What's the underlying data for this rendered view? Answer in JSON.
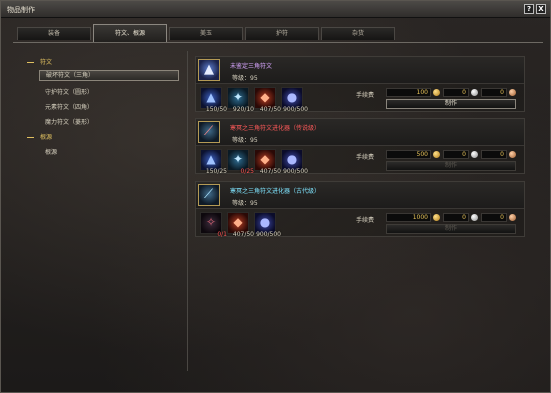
{
  "window": {
    "title": "物品制作",
    "help_label": "?",
    "close_label": "X"
  },
  "tabs": [
    {
      "label": "装备"
    },
    {
      "label": "符文、根源"
    },
    {
      "label": "美玉"
    },
    {
      "label": "护符"
    },
    {
      "label": "杂货"
    }
  ],
  "tree": {
    "cat1": "符文",
    "items1": [
      "破坏符文（三角）",
      "守护符文（圆形）",
      "元素符文（四角）",
      "魔力符文（菱形）"
    ],
    "cat2": "根源",
    "items2": [
      "根源"
    ]
  },
  "fee_label": "手续费",
  "recipes": [
    {
      "name": "未鉴定三角符文",
      "name_color": "#d8a6ff",
      "level": "等级：95",
      "icon": "sealed-rune-icon",
      "mats": [
        {
          "icon": "blue-rune-crystal-icon",
          "count": "150/50"
        },
        {
          "icon": "cyan-rune-essence-icon",
          "count": "920/10"
        },
        {
          "icon": "red-crystal-icon",
          "count": "407/50"
        },
        {
          "icon": "blue-orb-icon",
          "count": "900/500"
        }
      ],
      "gold": "100",
      "silver": "0",
      "copper": "0",
      "button": "制作",
      "enabled": true
    },
    {
      "name": "寒冥之三角符文进化器（传说级）",
      "name_color": "#ff5a5a",
      "level": "等级：95",
      "icon": "rune-evolver-wand-icon",
      "mats": [
        {
          "icon": "blue-rune-crystal-icon",
          "count": "150/25"
        },
        {
          "icon": "cyan-rune-essence-icon",
          "count": "0/25"
        },
        {
          "icon": "red-crystal-icon",
          "count": "407/50"
        },
        {
          "icon": "blue-orb-icon",
          "count": "900/500"
        }
      ],
      "gold": "500",
      "silver": "0",
      "copper": "0",
      "button": "制作",
      "enabled": false
    },
    {
      "name": "寒冥之三角符文进化器（古代级）",
      "name_color": "#7fe5ff",
      "level": "等级：95",
      "icon": "rune-evolver-wand-icon",
      "mats": [
        {
          "icon": "dark-rune-shard-icon",
          "count": "0/1"
        },
        {
          "icon": "red-crystal-icon",
          "count": "407/50"
        },
        {
          "icon": "blue-orb-icon",
          "count": "900/500"
        }
      ],
      "gold": "1000",
      "silver": "0",
      "copper": "0",
      "button": "制作",
      "enabled": false
    }
  ]
}
